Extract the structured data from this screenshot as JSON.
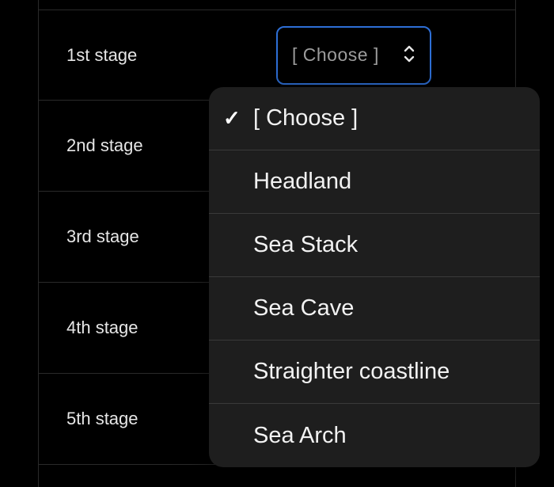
{
  "stages": [
    {
      "label": "1st stage"
    },
    {
      "label": "2nd stage"
    },
    {
      "label": "3rd stage"
    },
    {
      "label": "4th stage"
    },
    {
      "label": "5th stage"
    }
  ],
  "select": {
    "value": "[ Choose ]"
  },
  "dropdown": {
    "selected_index": 0,
    "options": [
      {
        "label": "[ Choose ]"
      },
      {
        "label": "Headland"
      },
      {
        "label": "Sea Stack"
      },
      {
        "label": "Sea Cave"
      },
      {
        "label": "Straighter coastline"
      },
      {
        "label": "Sea Arch"
      }
    ]
  }
}
